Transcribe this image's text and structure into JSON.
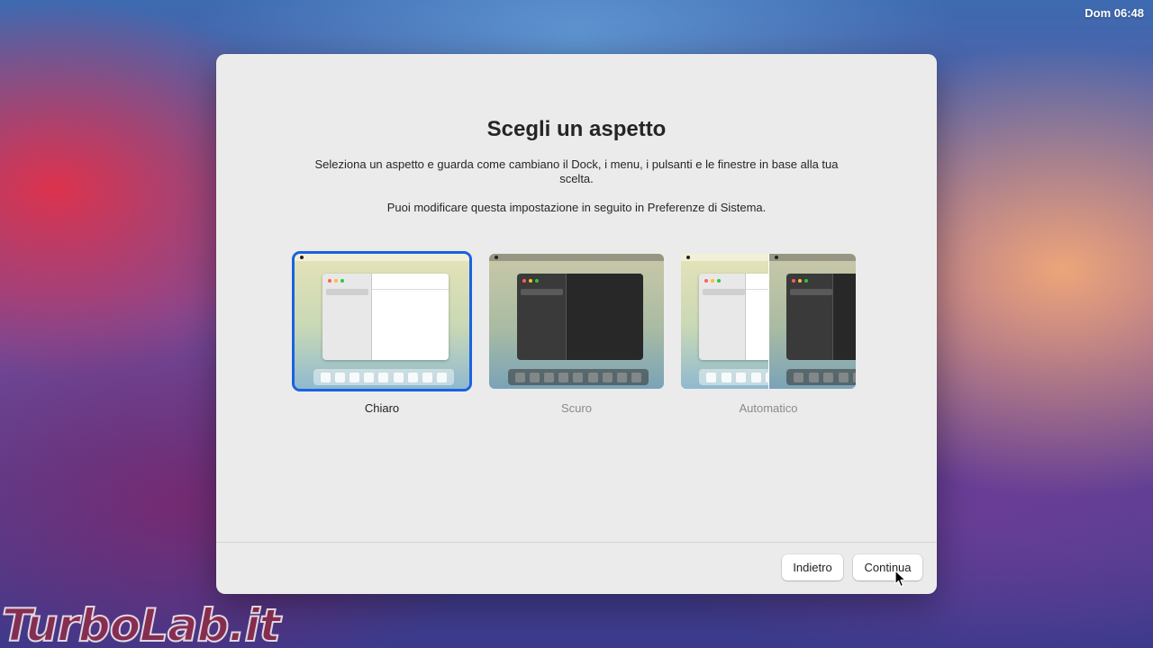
{
  "menubar": {
    "clock": "Dom 06:48"
  },
  "dialog": {
    "title": "Scegli un aspetto",
    "description": "Seleziona un aspetto e guarda come cambiano il Dock, i menu, i pulsanti e le finestre in base alla tua scelta.",
    "note": "Puoi modificare questa impostazione in seguito in Preferenze di Sistema.",
    "options": [
      {
        "label": "Chiaro",
        "selected": true
      },
      {
        "label": "Scuro",
        "selected": false
      },
      {
        "label": "Automatico",
        "selected": false
      }
    ],
    "buttons": {
      "back": "Indietro",
      "next": "Continua"
    }
  },
  "colors": {
    "selection_accent": "#1a62e0",
    "dialog_bg": "#ecebec"
  },
  "watermark": "TurboLab.it"
}
